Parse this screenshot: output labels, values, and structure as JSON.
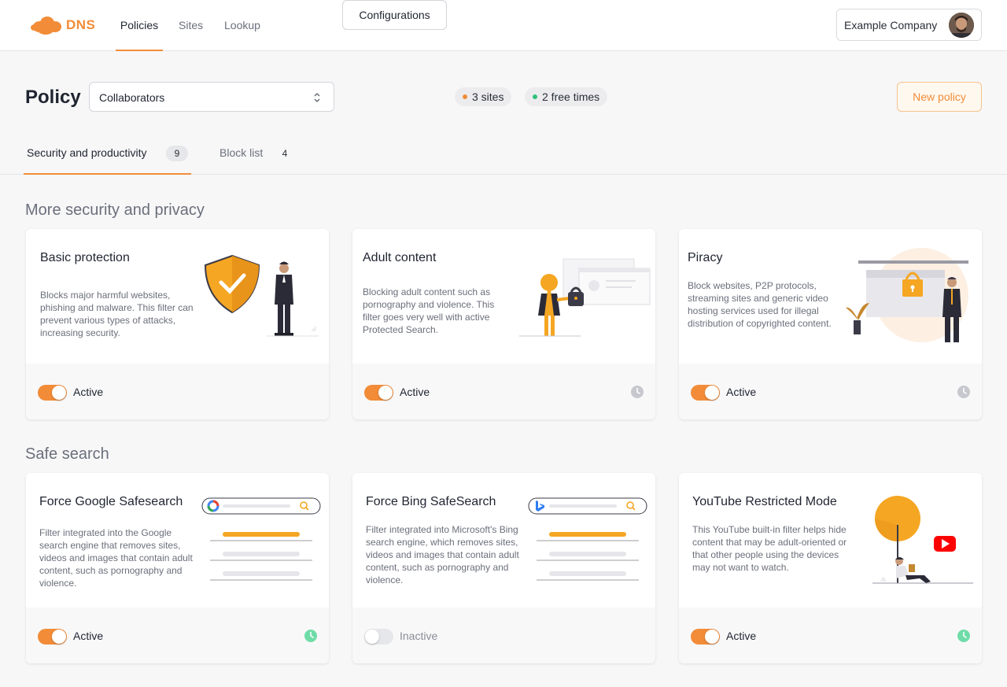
{
  "app": {
    "logo_text": "DNS"
  },
  "nav": [
    "Policies",
    "Sites",
    "Lookup"
  ],
  "account": {
    "company": "Example Company"
  },
  "toolbar": {
    "title": "Policy",
    "policy_select": "Collaborators",
    "configurations": "Configurations",
    "sites_pill": "3 sites",
    "times_pill": "2 free times",
    "new_policy": "New policy"
  },
  "tabs": [
    {
      "label": "Security and productivity",
      "count": "9"
    },
    {
      "label": "Block list",
      "count": "4"
    }
  ],
  "sections": [
    {
      "title": "More security and privacy",
      "cards": [
        {
          "title": "Basic protection",
          "description": "Blocks major harmful websites, phishing and malware. This filter can prevent various types of attacks, increasing security.",
          "status": "Active",
          "active": true,
          "clock": "none"
        },
        {
          "title": "Adult content",
          "description": "Blocking adult content such as pornography and violence. This filter goes very well with active Protected Search.",
          "status": "Active",
          "active": true,
          "clock": "gray"
        },
        {
          "title": "Piracy",
          "description": "Block websites, P2P protocols, streaming sites and generic video hosting services used for illegal distribution of copyrighted content.",
          "status": "Active",
          "active": true,
          "clock": "gray"
        }
      ]
    },
    {
      "title": "Safe search",
      "cards": [
        {
          "title": "Force Google Safesearch",
          "description": "Filter integrated into the Google search engine that removes sites, videos and images that contain adult content, such as pornography and violence.",
          "status": "Active",
          "active": true,
          "clock": "green"
        },
        {
          "title": "Force Bing SafeSearch",
          "description": "Filter integrated into Microsoft's Bing search engine, which removes sites, videos and images that contain adult content, such as pornography and violence.",
          "status": "Inactive",
          "active": false,
          "clock": "green"
        },
        {
          "title": "YouTube Restricted Mode",
          "description": "This YouTube built-in filter helps hide content that may be adult-oriented or that other people using the devices may not want to watch.",
          "status": "Active",
          "active": true,
          "clock": "green"
        }
      ]
    }
  ],
  "colors": {
    "accent": "#f28c38",
    "sites_dot": "#f28c38",
    "times_dot": "#2ec27e",
    "clock_gray": "#c6c8cd",
    "clock_green": "#6fdca8"
  }
}
